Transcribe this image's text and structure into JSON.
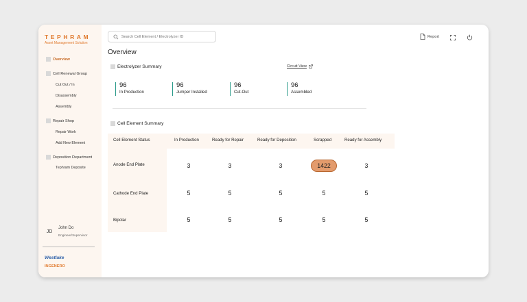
{
  "brand": {
    "name": "TEPHRAM",
    "subtitle": "Asset Management Solution"
  },
  "search": {
    "placeholder": "Search Cell Element / Electrolyzer ID"
  },
  "topbar": {
    "report_label": "Report"
  },
  "sidebar": {
    "groups": [
      {
        "label": "Overview",
        "active": true,
        "items": []
      },
      {
        "label": "Cell Renewal Group",
        "items": [
          "Cut Out / In",
          "Disassembly",
          "Assembly"
        ]
      },
      {
        "label": "Repair Shop",
        "items": [
          "Repair Work",
          "Add New Element"
        ]
      },
      {
        "label": "Deposition Department",
        "items": [
          "Tephram Deposite"
        ]
      }
    ]
  },
  "user": {
    "initials": "JD",
    "name": "John Do",
    "role": "Engineer/Supervisor"
  },
  "partners": {
    "logo1": "Westlake",
    "logo2": "INGENERO"
  },
  "page": {
    "title": "Overview"
  },
  "electrolyzer_summary": {
    "title": "Electrolyzer Summary",
    "link": "Circuit View",
    "stats": [
      {
        "value": "96",
        "label": "In Production"
      },
      {
        "value": "96",
        "label": "Jumper Installed"
      },
      {
        "value": "96",
        "label": "Cut-Out"
      },
      {
        "value": "96",
        "label": "Assembled"
      }
    ]
  },
  "cell_element_summary": {
    "title": "Cell Element Summary",
    "columns": [
      "Cell Element Status",
      "In Production",
      "Ready for Repair",
      "Ready for Deposition",
      "Scrapped",
      "Ready for Assembly"
    ],
    "rows": [
      {
        "label": "Anode End Plate",
        "values": [
          "3",
          "3",
          "3",
          "1422",
          "3"
        ]
      },
      {
        "label": "Cathode End Plate",
        "values": [
          "5",
          "5",
          "5",
          "5",
          "5"
        ]
      },
      {
        "label": "Bipolar",
        "values": [
          "5",
          "5",
          "5",
          "5",
          "5"
        ]
      }
    ],
    "highlight_color": "#e39b6c"
  },
  "colors": {
    "accent": "#e07a2e",
    "stat_border": "#2b9b8a",
    "sidebar_bg": "#fdf6f0"
  }
}
